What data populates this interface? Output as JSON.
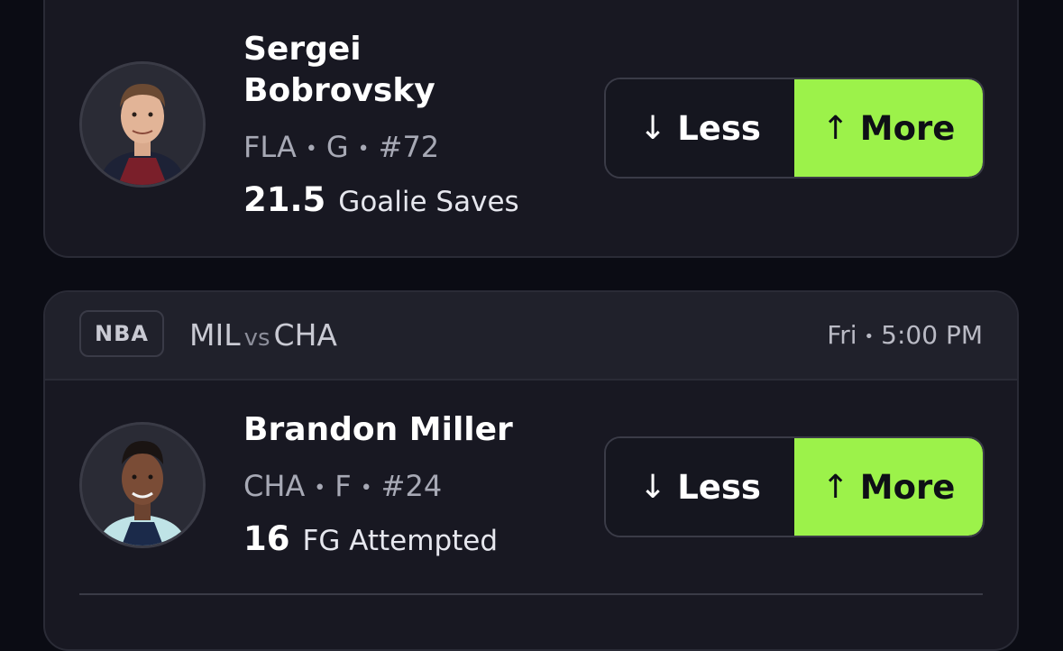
{
  "props": [
    {
      "player": {
        "name_line1": "Sergei",
        "name_line2": "Bobrovsky",
        "team": "FLA",
        "position": "G",
        "number": "#72"
      },
      "line": {
        "value": "21.5",
        "stat": "Goalie Saves"
      },
      "less_label": "Less",
      "more_label": "More"
    },
    {
      "game": {
        "league": "NBA",
        "home": "MIL",
        "vs": "vs",
        "away": "CHA",
        "day": "Fri",
        "time": "5:00 PM"
      },
      "player": {
        "name": "Brandon Miller",
        "team": "CHA",
        "position": "F",
        "number": "#24"
      },
      "line": {
        "value": "16",
        "stat": "FG Attempted"
      },
      "less_label": "Less",
      "more_label": "More"
    }
  ],
  "separator": "•",
  "icons": {
    "less": "arrow-down-icon",
    "more": "arrow-up-icon"
  },
  "colors": {
    "more_accent": "#9cf24a",
    "card_bg": "#181822",
    "page_bg": "#0b0c14"
  }
}
